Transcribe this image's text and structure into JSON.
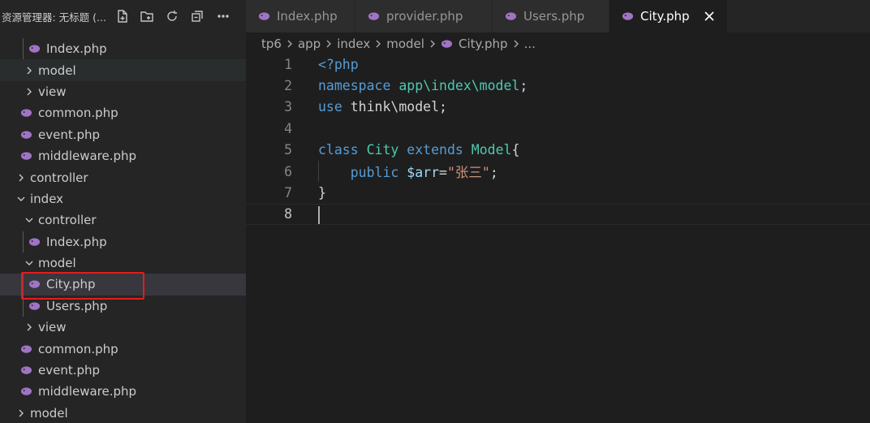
{
  "sidebar": {
    "title": "资源管理器: 无标题 (...",
    "actions": [
      "new-file-icon",
      "new-folder-icon",
      "refresh-icon",
      "collapse-all-icon",
      "more-icon"
    ],
    "tree": [
      {
        "label": "Index.php",
        "type": "file"
      },
      {
        "label": "model",
        "type": "folder",
        "expanded": false
      },
      {
        "label": "view",
        "type": "folder",
        "expanded": false
      },
      {
        "label": "common.php",
        "type": "file"
      },
      {
        "label": "event.php",
        "type": "file"
      },
      {
        "label": "middleware.php",
        "type": "file"
      },
      {
        "label": "controller",
        "type": "folder",
        "expanded": false
      },
      {
        "label": "index",
        "type": "folder",
        "expanded": true
      },
      {
        "label": "controller",
        "type": "folder",
        "expanded": true
      },
      {
        "label": "Index.php",
        "type": "file"
      },
      {
        "label": "model",
        "type": "folder",
        "expanded": true
      },
      {
        "label": "City.php",
        "type": "file",
        "selected": true
      },
      {
        "label": "Users.php",
        "type": "file"
      },
      {
        "label": "view",
        "type": "folder",
        "expanded": false
      },
      {
        "label": "common.php",
        "type": "file"
      },
      {
        "label": "event.php",
        "type": "file"
      },
      {
        "label": "middleware.php",
        "type": "file"
      },
      {
        "label": "model",
        "type": "folder",
        "expanded": false
      }
    ]
  },
  "tabs": [
    {
      "label": "Index.php",
      "active": false
    },
    {
      "label": "provider.php",
      "active": false
    },
    {
      "label": "Users.php",
      "active": false
    },
    {
      "label": "City.php",
      "active": true
    }
  ],
  "breadcrumb": {
    "items": [
      "tp6",
      "app",
      "index",
      "model",
      "City.php"
    ],
    "ellipsis": "..."
  },
  "editor": {
    "lines": [
      {
        "n": "1",
        "tokens": [
          [
            "tag",
            "<?php"
          ]
        ]
      },
      {
        "n": "2",
        "tokens": [
          [
            "kw",
            "namespace "
          ],
          [
            "ns",
            "app\\index\\model"
          ],
          [
            "txt",
            ";"
          ]
        ]
      },
      {
        "n": "3",
        "tokens": [
          [
            "kw",
            "use "
          ],
          [
            "txt",
            "think\\model;"
          ]
        ]
      },
      {
        "n": "4",
        "tokens": []
      },
      {
        "n": "5",
        "tokens": [
          [
            "kw",
            "class "
          ],
          [
            "cls",
            "City "
          ],
          [
            "kw",
            "extends "
          ],
          [
            "cls",
            "Model"
          ],
          [
            "txt",
            "{"
          ]
        ]
      },
      {
        "n": "6",
        "tokens": [
          [
            "txt",
            "    "
          ],
          [
            "kw",
            "public "
          ],
          [
            "var",
            "$arr"
          ],
          [
            "txt",
            "="
          ],
          [
            "str",
            "\"张三\""
          ],
          [
            "txt",
            ";"
          ]
        ]
      },
      {
        "n": "7",
        "tokens": [
          [
            "txt",
            "}"
          ]
        ]
      },
      {
        "n": "8",
        "tokens": [],
        "current": true
      }
    ]
  },
  "colors": {
    "sidebar_bg": "#252526",
    "editor_bg": "#1e1e1e",
    "selection": "#37373d",
    "highlight_box": "#e81b1b",
    "php_icon": "#a074c4"
  }
}
